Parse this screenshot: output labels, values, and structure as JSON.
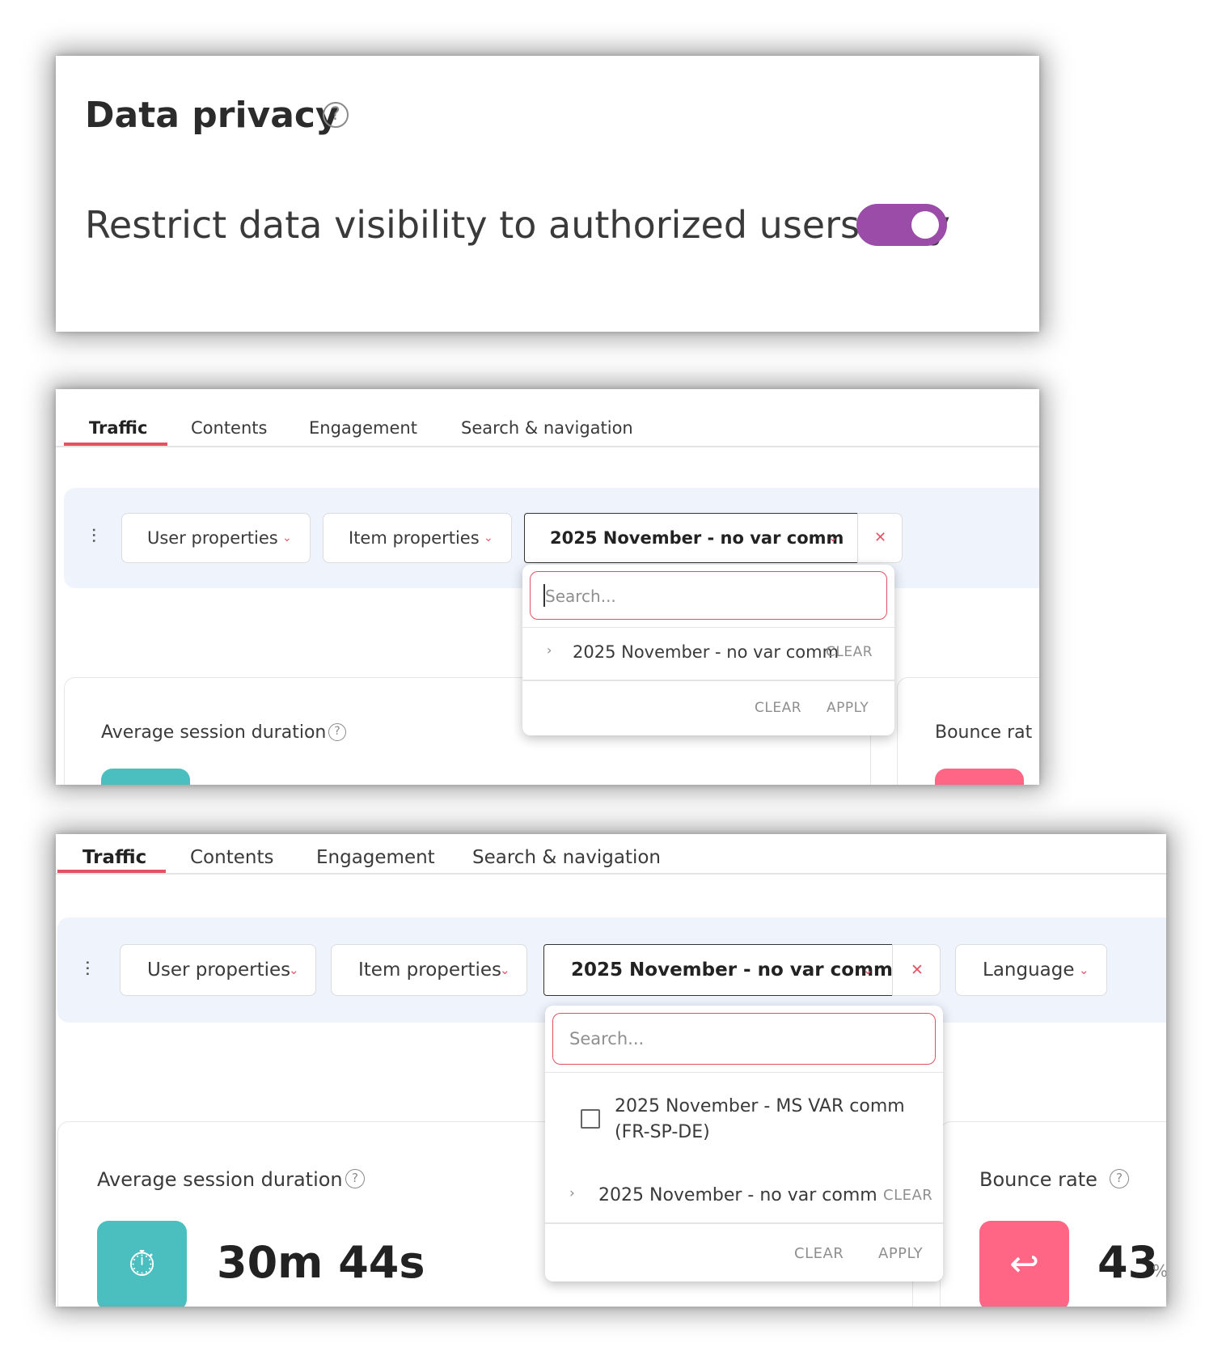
{
  "privacy": {
    "title": "Data privacy",
    "help_icon": "question-circle-icon",
    "setting_label": "Restrict data visibility to authorized users only",
    "toggle_on": true,
    "toggle_color": "#9b4ba8"
  },
  "tabs": [
    "Traffic",
    "Contents",
    "Engagement",
    "Search & navigation"
  ],
  "filters": {
    "user_properties": "User properties",
    "item_properties": "Item properties",
    "selected": "2025 November - no var comm",
    "language": "Language",
    "clear_icon": "close-icon",
    "filter_icon": "sliders-icon"
  },
  "dropdown": {
    "search_placeholder": "Search...",
    "option_unchecked": "2025 November - MS VAR comm",
    "option_unchecked_sub": "(FR-SP-DE)",
    "selected_item": "2025 November - no var comm",
    "item_clear": "CLEAR",
    "footer_clear": "CLEAR",
    "footer_apply": "APPLY"
  },
  "cards": {
    "avg_session": {
      "title": "Average session duration",
      "value": "30m 44s",
      "icon": "stopwatch-icon",
      "color": "#4bbfbf"
    },
    "bounce": {
      "title": "Bounce rate",
      "title_cropped": "Bounce rat",
      "value": "43",
      "unit": "%",
      "icon": "reply-all-icon",
      "color": "#ff6584"
    }
  },
  "colors": {
    "accent": "#e35260",
    "filterbar_bg": "#eef3fc"
  }
}
